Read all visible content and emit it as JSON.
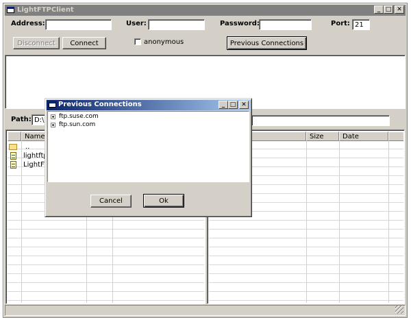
{
  "window": {
    "title": "LightFTPClient"
  },
  "connection": {
    "address_label": "Address:",
    "address_value": "",
    "user_label": "User:",
    "user_value": "",
    "password_label": "Password:",
    "password_value": "",
    "port_label": "Port:",
    "port_value": "21",
    "disconnect_label": "Disconnect",
    "connect_label": "Connect",
    "anonymous_label": "anonymous",
    "anonymous_checked": false,
    "previous_connections_label": "Previous Connections"
  },
  "local_pane": {
    "path_label": "Path:",
    "path_value": "D:\\W",
    "columns": [
      "",
      "Name"
    ],
    "rows": [
      {
        "icon": "folder-icon",
        "name": ".."
      },
      {
        "icon": "file-icon",
        "name": "lightftp"
      },
      {
        "icon": "file-icon",
        "name": "LightFT"
      }
    ]
  },
  "remote_pane": {
    "path_value": "",
    "columns": [
      "",
      "Size",
      "Date"
    ]
  },
  "dialog": {
    "title": "Previous Connections",
    "items": [
      "ftp.suse.com",
      "ftp.sun.com"
    ],
    "cancel_label": "Cancel",
    "ok_label": "Ok"
  }
}
